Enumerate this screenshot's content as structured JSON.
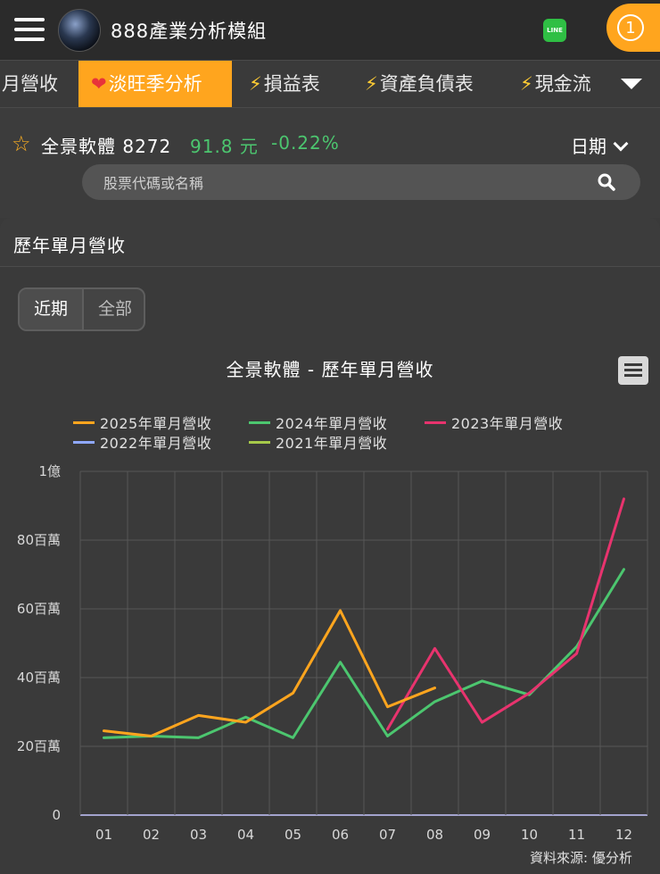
{
  "header": {
    "app_title": "888產業分析模組",
    "line_label": "LINE",
    "notification_count": "1"
  },
  "tabs": [
    {
      "label": "月營收",
      "icon": "",
      "active": false
    },
    {
      "label": "淡旺季分析",
      "icon": "heart-icon",
      "active": true
    },
    {
      "label": "損益表",
      "icon": "bolt-icon",
      "active": false
    },
    {
      "label": "資產負債表",
      "icon": "bolt-icon",
      "active": false
    },
    {
      "label": "現金流",
      "icon": "bolt-icon",
      "active": false
    }
  ],
  "stock": {
    "name": "全景軟體 8272",
    "price": "91.8 元",
    "change": "-0.22%",
    "date_label": "日期"
  },
  "search": {
    "placeholder": "股票代碼或名稱"
  },
  "section": {
    "title": "歷年單月營收",
    "toggle": [
      "近期",
      "全部"
    ]
  },
  "source_text": "資料來源: 優分析",
  "colors": {
    "accent": "#ffa51e",
    "positive": "#4cc66f",
    "s2025": "#ffa51e",
    "s2024": "#4cc66f",
    "s2023": "#e8336e",
    "s2022": "#8fa8ff",
    "s2021": "#a6c94a"
  },
  "chart_data": {
    "type": "line",
    "title": "全景軟體 - 歷年單月營收",
    "categories": [
      "01",
      "02",
      "03",
      "04",
      "05",
      "06",
      "07",
      "08",
      "09",
      "10",
      "11",
      "12"
    ],
    "ylim": [
      0,
      100
    ],
    "yticks": [
      0,
      20,
      40,
      60,
      80,
      100
    ],
    "ytick_labels": [
      "0",
      "20百萬",
      "40百萬",
      "60百萬",
      "80百萬",
      "1億"
    ],
    "grid": true,
    "legend_position": "top",
    "series": [
      {
        "name": "2025年單月營收",
        "color": "#ffa51e",
        "values": [
          24.5,
          23,
          29,
          27,
          35.5,
          59.5,
          31.5,
          37,
          null,
          null,
          null,
          null
        ]
      },
      {
        "name": "2024年單月營收",
        "color": "#4cc66f",
        "values": [
          22.5,
          23,
          22.5,
          28.5,
          22.5,
          44.5,
          23,
          33,
          39,
          35,
          49,
          71.5
        ]
      },
      {
        "name": "2023年單月營收",
        "color": "#e8336e",
        "values": [
          null,
          null,
          null,
          null,
          null,
          null,
          25,
          48.5,
          27,
          35.5,
          47,
          92
        ]
      },
      {
        "name": "2022年單月營收",
        "color": "#8fa8ff",
        "values": []
      },
      {
        "name": "2021年單月營收",
        "color": "#a6c94a",
        "values": []
      }
    ]
  }
}
